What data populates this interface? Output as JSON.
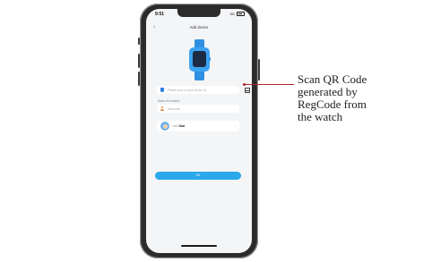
{
  "status": {
    "time": "9:51",
    "network": "5G"
  },
  "header": {
    "back_icon": "chevron-left-icon",
    "title": "Add device"
  },
  "device_input": {
    "placeholder": "Please scan or input device ID",
    "scan_icon": "qr-scan-icon"
  },
  "basic_info": {
    "section_label": "Basic information",
    "nickname_placeholder": "Nickname",
    "relation_prefix": "I am",
    "relation_value": "Dad"
  },
  "ok_button": {
    "label": "OK"
  },
  "callout": {
    "lines": [
      "Scan QR Code",
      "generated by",
      "RegCode from",
      "the watch"
    ]
  },
  "colors": {
    "accent": "#2aa8ea",
    "callout_line": "#b22525",
    "watch": "#3ba3f2"
  }
}
